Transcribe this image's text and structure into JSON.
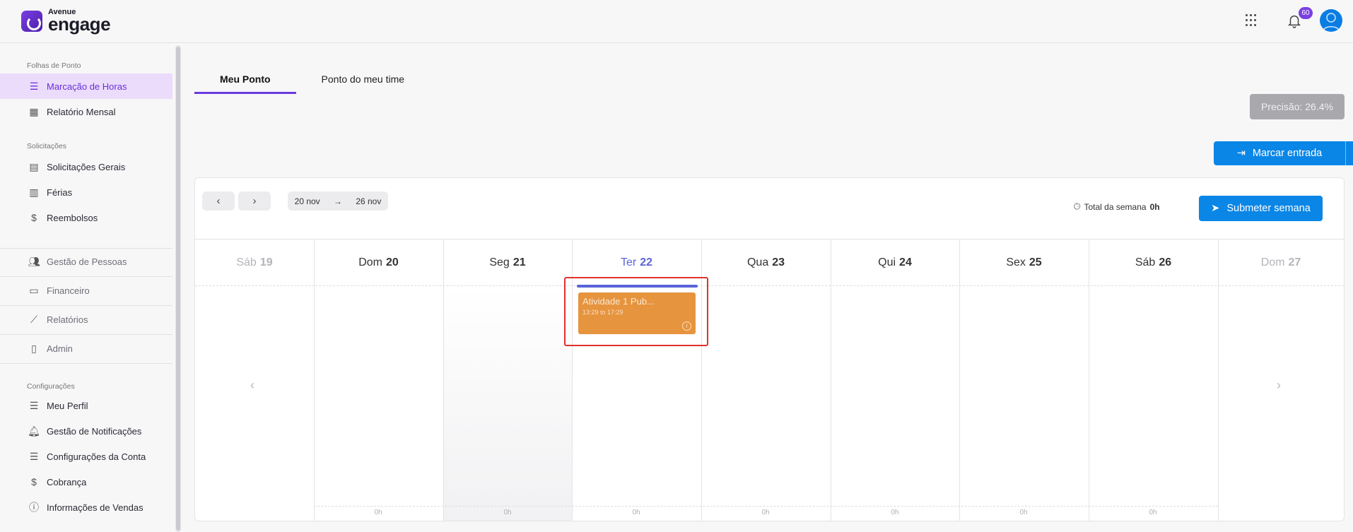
{
  "header": {
    "logo_small": "Avenue",
    "logo_big": "engage",
    "notifications_count": "60",
    "icons": [
      "apps-grid-icon",
      "bell-icon",
      "user-avatar-icon"
    ]
  },
  "sidebar": {
    "sections": [
      {
        "label": "Folhas de Ponto"
      },
      {
        "label": "Solicitações"
      },
      {
        "label": "Configurações"
      }
    ],
    "items": [
      {
        "label": "Marcação de Horas",
        "icon": "timesheet-icon",
        "active": true
      },
      {
        "label": "Relatório Mensal",
        "icon": "calendar-icon"
      },
      {
        "label": "Solicitações Gerais",
        "icon": "document-icon"
      },
      {
        "label": "Férias",
        "icon": "suitcase-icon"
      },
      {
        "label": "Reembolsos",
        "icon": "dollar-icon"
      },
      {
        "label": "Gestão de Pessoas",
        "icon": "people-icon"
      },
      {
        "label": "Financeiro",
        "icon": "credit-card-icon"
      },
      {
        "label": "Relatórios",
        "icon": "chart-line-icon"
      },
      {
        "label": "Admin",
        "icon": "clipboard-icon"
      },
      {
        "label": "Meu Perfil",
        "icon": "list-icon"
      },
      {
        "label": "Gestão de Notificações",
        "icon": "bell-icon"
      },
      {
        "label": "Configurações da Conta",
        "icon": "list-icon"
      },
      {
        "label": "Cobrança",
        "icon": "dollar-icon"
      },
      {
        "label": "Informações de Vendas",
        "icon": "info-icon"
      }
    ]
  },
  "tabs": [
    {
      "label": "Meu Ponto",
      "active": true
    },
    {
      "label": "Ponto do meu time"
    }
  ],
  "precisao": "Precisão: 26.4%",
  "marcar_entrada": "Marcar entrada",
  "week": {
    "from": "20 nov",
    "to": "26 nov",
    "total_label": "Total da semana",
    "total_value": "0h",
    "submit_label": "Submeter semana"
  },
  "days": [
    {
      "name": "Sáb",
      "num": "19"
    },
    {
      "name": "Dom",
      "num": "20",
      "total": "0h"
    },
    {
      "name": "Seg",
      "num": "21",
      "total": "0h"
    },
    {
      "name": "Ter",
      "num": "22",
      "total": "0h"
    },
    {
      "name": "Qua",
      "num": "23",
      "total": "0h"
    },
    {
      "name": "Qui",
      "num": "24",
      "total": "0h"
    },
    {
      "name": "Sex",
      "num": "25",
      "total": "0h"
    },
    {
      "name": "Sáb",
      "num": "26",
      "total": "0h"
    },
    {
      "name": "Dom",
      "num": "27"
    }
  ],
  "event": {
    "title": "Atividade 1 Pub...",
    "time": "13:29 to 17:29",
    "color": "#e6943e"
  },
  "colors": {
    "accent": "#6b3be0",
    "primary_button": "#0a86e6",
    "today": "#5a63d9",
    "highlight": "#e0322b"
  }
}
